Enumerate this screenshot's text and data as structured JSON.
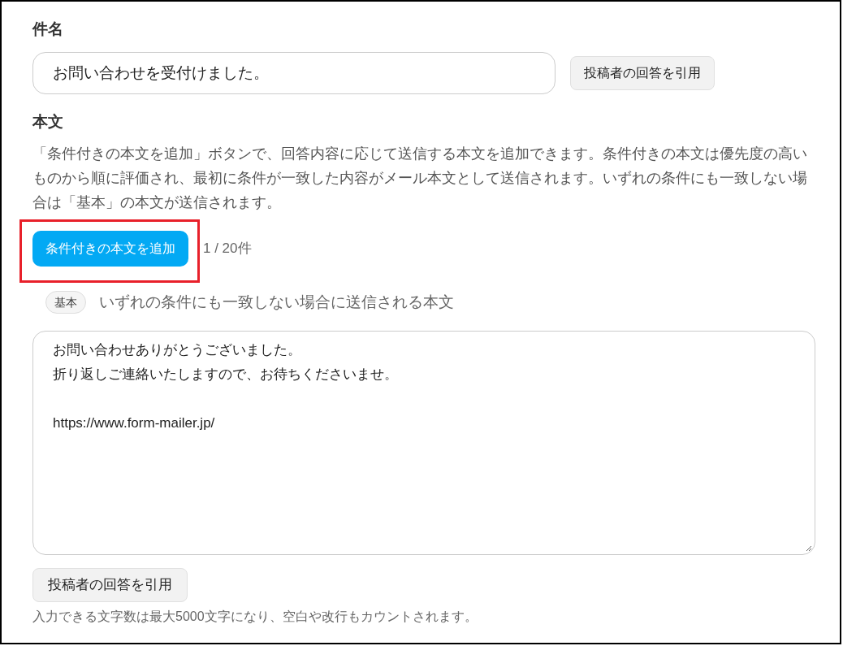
{
  "subject": {
    "label": "件名",
    "value": "お問い合わせを受付けました。",
    "quote_button": "投稿者の回答を引用"
  },
  "body": {
    "label": "本文",
    "description": "「条件付きの本文を追加」ボタンで、回答内容に応じて送信する本文を追加できます。条件付きの本文は優先度の高いものから順に評価され、最初に条件が一致した内容がメール本文として送信されます。いずれの条件にも一致しない場合は「基本」の本文が送信されます。",
    "add_button": "条件付きの本文を追加",
    "add_button_highlighted": true,
    "count": "1 / 20件",
    "default_tag": "基本",
    "default_caption": "いずれの条件にも一致しない場合に送信される本文",
    "paragraphs": [
      [
        "お問い合わせありがとうございました。",
        "折り返しご連絡いたしますので、お待ちくださいませ。"
      ],
      [
        "https://www.form-mailer.jp/"
      ]
    ],
    "quote_button": "投稿者の回答を引用",
    "note": "入力できる文字数は最大5000文字になり、空白や改行もカウントされます。"
  }
}
